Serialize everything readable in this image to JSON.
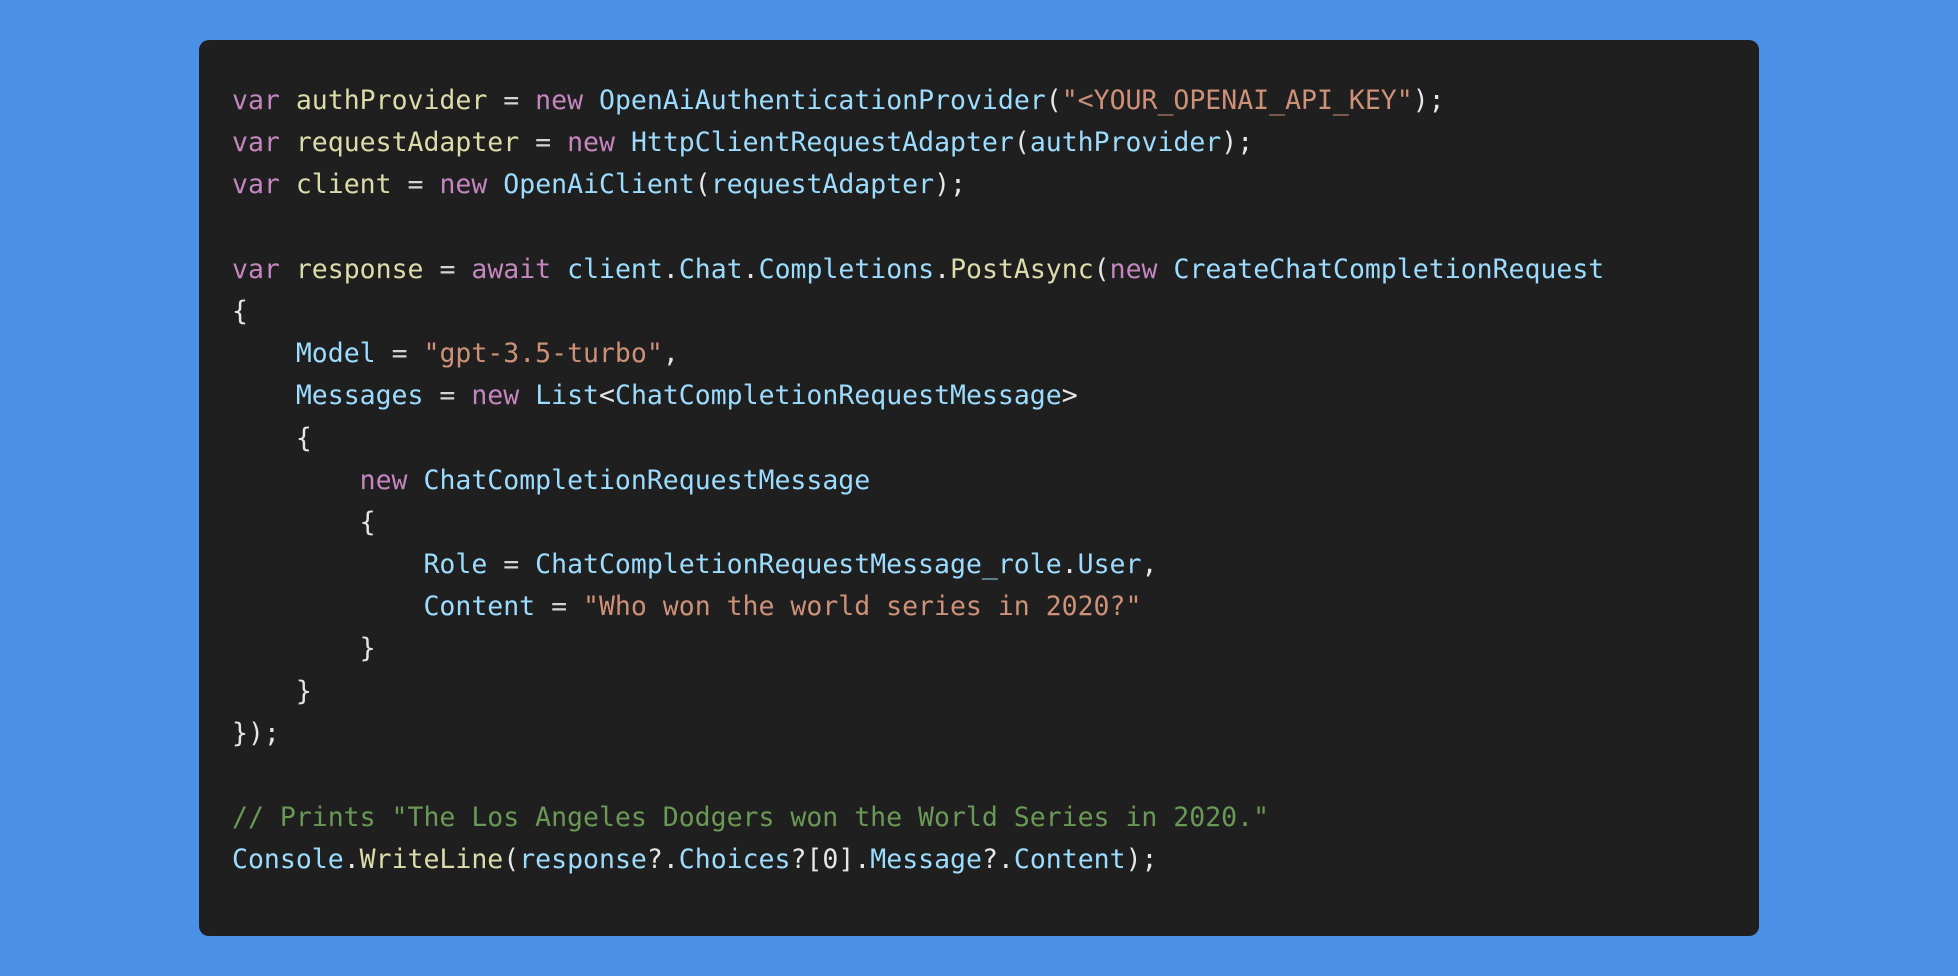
{
  "colors": {
    "background": "#4a90e6",
    "editor_background": "#1f1f1f",
    "keyword": "#c586c0",
    "variable": "#dcdcaa",
    "type": "#9cdcfe",
    "string": "#ce9178",
    "comment": "#6a9955",
    "plain": "#e6e6e6"
  },
  "code": {
    "lines": [
      [
        {
          "t": "var",
          "c": "kw"
        },
        {
          "t": " ",
          "c": "plain"
        },
        {
          "t": "authProvider",
          "c": "var"
        },
        {
          "t": " = ",
          "c": "op"
        },
        {
          "t": "new",
          "c": "kw"
        },
        {
          "t": " ",
          "c": "plain"
        },
        {
          "t": "OpenAiAuthenticationProvider",
          "c": "type"
        },
        {
          "t": "(",
          "c": "plain"
        },
        {
          "t": "\"<YOUR_OPENAI_API_KEY\"",
          "c": "str"
        },
        {
          "t": ");",
          "c": "plain"
        }
      ],
      [
        {
          "t": "var",
          "c": "kw"
        },
        {
          "t": " ",
          "c": "plain"
        },
        {
          "t": "requestAdapter",
          "c": "var"
        },
        {
          "t": " = ",
          "c": "op"
        },
        {
          "t": "new",
          "c": "kw"
        },
        {
          "t": " ",
          "c": "plain"
        },
        {
          "t": "HttpClientRequestAdapter",
          "c": "type"
        },
        {
          "t": "(",
          "c": "plain"
        },
        {
          "t": "authProvider",
          "c": "prop"
        },
        {
          "t": ");",
          "c": "plain"
        }
      ],
      [
        {
          "t": "var",
          "c": "kw"
        },
        {
          "t": " ",
          "c": "plain"
        },
        {
          "t": "client",
          "c": "var"
        },
        {
          "t": " = ",
          "c": "op"
        },
        {
          "t": "new",
          "c": "kw"
        },
        {
          "t": " ",
          "c": "plain"
        },
        {
          "t": "OpenAiClient",
          "c": "type"
        },
        {
          "t": "(",
          "c": "plain"
        },
        {
          "t": "requestAdapter",
          "c": "prop"
        },
        {
          "t": ");",
          "c": "plain"
        }
      ],
      [],
      [
        {
          "t": "var",
          "c": "kw"
        },
        {
          "t": " ",
          "c": "plain"
        },
        {
          "t": "response",
          "c": "var"
        },
        {
          "t": " = ",
          "c": "op"
        },
        {
          "t": "await",
          "c": "kw"
        },
        {
          "t": " ",
          "c": "plain"
        },
        {
          "t": "client",
          "c": "prop"
        },
        {
          "t": ".",
          "c": "plain"
        },
        {
          "t": "Chat",
          "c": "prop"
        },
        {
          "t": ".",
          "c": "plain"
        },
        {
          "t": "Completions",
          "c": "prop"
        },
        {
          "t": ".",
          "c": "plain"
        },
        {
          "t": "PostAsync",
          "c": "fn"
        },
        {
          "t": "(",
          "c": "plain"
        },
        {
          "t": "new",
          "c": "kw"
        },
        {
          "t": " ",
          "c": "plain"
        },
        {
          "t": "CreateChatCompletionRequest",
          "c": "type"
        }
      ],
      [
        {
          "t": "{",
          "c": "plain"
        }
      ],
      [
        {
          "t": "    ",
          "c": "plain"
        },
        {
          "t": "Model",
          "c": "prop"
        },
        {
          "t": " = ",
          "c": "op"
        },
        {
          "t": "\"gpt-3.5-turbo\"",
          "c": "str"
        },
        {
          "t": ",",
          "c": "plain"
        }
      ],
      [
        {
          "t": "    ",
          "c": "plain"
        },
        {
          "t": "Messages",
          "c": "prop"
        },
        {
          "t": " = ",
          "c": "op"
        },
        {
          "t": "new",
          "c": "kw"
        },
        {
          "t": " ",
          "c": "plain"
        },
        {
          "t": "List",
          "c": "type"
        },
        {
          "t": "<",
          "c": "plain"
        },
        {
          "t": "ChatCompletionRequestMessage",
          "c": "type"
        },
        {
          "t": ">",
          "c": "plain"
        }
      ],
      [
        {
          "t": "    {",
          "c": "plain"
        }
      ],
      [
        {
          "t": "        ",
          "c": "plain"
        },
        {
          "t": "new",
          "c": "kw"
        },
        {
          "t": " ",
          "c": "plain"
        },
        {
          "t": "ChatCompletionRequestMessage",
          "c": "type"
        }
      ],
      [
        {
          "t": "        {",
          "c": "plain"
        }
      ],
      [
        {
          "t": "            ",
          "c": "plain"
        },
        {
          "t": "Role",
          "c": "prop"
        },
        {
          "t": " = ",
          "c": "op"
        },
        {
          "t": "ChatCompletionRequestMessage_role",
          "c": "type"
        },
        {
          "t": ".",
          "c": "plain"
        },
        {
          "t": "User",
          "c": "prop"
        },
        {
          "t": ",",
          "c": "plain"
        }
      ],
      [
        {
          "t": "            ",
          "c": "plain"
        },
        {
          "t": "Content",
          "c": "prop"
        },
        {
          "t": " = ",
          "c": "op"
        },
        {
          "t": "\"Who won the world series in 2020?\"",
          "c": "str"
        }
      ],
      [
        {
          "t": "        }",
          "c": "plain"
        }
      ],
      [
        {
          "t": "    }",
          "c": "plain"
        }
      ],
      [
        {
          "t": "});",
          "c": "plain"
        }
      ],
      [],
      [
        {
          "t": "// Prints \"The Los Angeles Dodgers won the World Series in 2020.\"",
          "c": "cmt"
        }
      ],
      [
        {
          "t": "Console",
          "c": "type"
        },
        {
          "t": ".",
          "c": "plain"
        },
        {
          "t": "WriteLine",
          "c": "fn"
        },
        {
          "t": "(",
          "c": "plain"
        },
        {
          "t": "response",
          "c": "prop"
        },
        {
          "t": "?.",
          "c": "plain"
        },
        {
          "t": "Choices",
          "c": "prop"
        },
        {
          "t": "?[",
          "c": "plain"
        },
        {
          "t": "0",
          "c": "plain"
        },
        {
          "t": "].",
          "c": "plain"
        },
        {
          "t": "Message",
          "c": "prop"
        },
        {
          "t": "?.",
          "c": "plain"
        },
        {
          "t": "Content",
          "c": "prop"
        },
        {
          "t": ");",
          "c": "plain"
        }
      ]
    ]
  }
}
